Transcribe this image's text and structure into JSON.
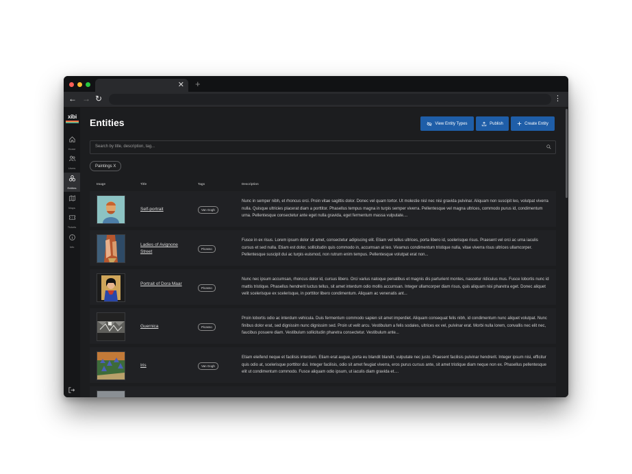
{
  "browser": {
    "tab_close": "✕",
    "new_tab": "+",
    "back": "←",
    "forward": "→",
    "reload": "↻",
    "menu": "⋮"
  },
  "sidebar": {
    "logo": "xibi",
    "items": [
      {
        "label": "Home",
        "icon": "home-icon"
      },
      {
        "label": "Users",
        "icon": "users-icon"
      },
      {
        "label": "Entities",
        "icon": "entities-icon"
      },
      {
        "label": "Maps",
        "icon": "map-icon"
      },
      {
        "label": "Tickets",
        "icon": "ticket-icon"
      },
      {
        "label": "Info",
        "icon": "info-icon"
      }
    ],
    "logout_icon": "logout-icon"
  },
  "header": {
    "title": "Entities",
    "view_types_label": "View Entity Types",
    "publish_label": "Publish",
    "create_label": "Create Entity"
  },
  "search": {
    "placeholder": "Search by title, description, tag..."
  },
  "filter_chip": "Paintings X",
  "table": {
    "columns": [
      "Image",
      "Title",
      "Tags",
      "Description"
    ],
    "rows": [
      {
        "title": "Self-portrait",
        "tag": "Van Gogh",
        "description": "Nunc in semper nibh, et rhoncus orci. Proin vitae sagittis dolor. Donec vel quam tortor. Ut molestie nisl nec nisi gravida pulvinar. Aliquam non suscipit leo, volutpat viverra nulla. Quisque ultricies placerat diam a porttitor. Phasellus tempus magna in turpis semper viverra. Pellentesque vel magna ultrices, commodo purus id, condimentum urna. Pellentesque consectetur ante eget nulla gravida, eget fermentum massa vulputate...."
      },
      {
        "title": "Ladies of Avignone Street",
        "tag": "Picasso",
        "description": "Fusce in ex risus. Lorem ipsum dolor sit amet, consectetur adipiscing elit. Etiam vel tellus ultrices, porta libero id, scelerisque risus. Praesent vel orci ac urna iaculis cursus et sed nulla. Etiam est dolor, sollicitudin quis commodo in, accumsan at leo. Vivamus condimentum tristique nulla, vitae viverra risus ultrices ullamcorper. Pellentesque suscipit dui ac turpis euismod, non rutrum enim tempus. Pellentesque volutpat erat non..."
      },
      {
        "title": "Portrait of Dora Maar",
        "tag": "Picasso",
        "description": "Nunc nec ipsum accumsan, rhoncus dolor id, cursus libero. Orci varius natoque penatibus et magnis dis parturient montes, nascetur ridiculus mus. Fusce lobortis nunc id mattis tristique. Phasellus hendrerit luctus tellus, sit amet interdum odio mollis accumsan. Integer ullamcorper diam risus, quis aliquam nisi pharetra eget. Donec aliquet velit scelerisque ex scelerisque, in porttitor libero condimentum. Aliquam ac venenatis ant..."
      },
      {
        "title": "Guernica",
        "tag": "Picasso",
        "description": "Proin lobortis odio ac interdum vehicula. Duis fermentum commodo sapien sit amet imperdiet. Aliquam consequat felis nibh, id condimentum nunc aliquet volutpat. Nunc finibus dolor erat, sed dignissim nunc dignissim sed. Proin ut velit arcu. Vestibulum a felis sodales, ultrices ex vel, pulvinar erat. Morbi nulla lorem, convallis nec elit nec, faucibus posuere diam. Vestibulum sollicitudin pharetra consectetur. Vestibulum ante..."
      },
      {
        "title": "Iris",
        "tag": "Van Gogh",
        "description": "Etiam eleifend neque et facilisis interdum. Etiam erat augue, porta eu blandit blandit, vulputate nec justo. Praesent facilisis pulvinar hendrerit. Integer ipsum nisi, efficitur quis odio at, scelerisque porttitor dui. Integer facilisis, odio sit amet feugiat viverra, eros purus cursus ante, sit amet tristique diam neque non ex. Phasellus pellentesque elit ut condimentum commodo. Fusce aliquam odio ipsum, ut iaculis diam gravida et...."
      }
    ]
  },
  "colors": {
    "accent": "#1f5ea8",
    "background": "#1c1d1f",
    "sidebar": "#161719"
  }
}
